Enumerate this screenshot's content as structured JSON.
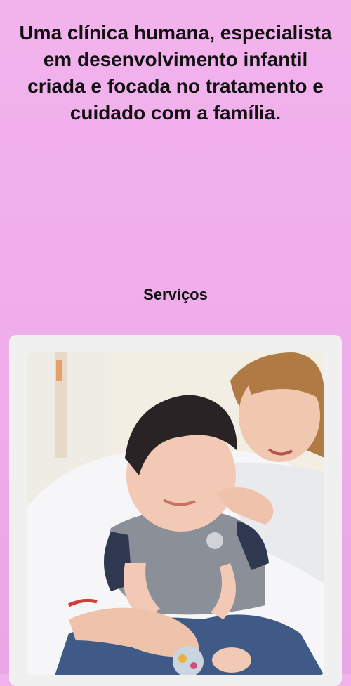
{
  "hero": {
    "text": "Uma clínica humana, especialista em desenvolvimento infantil criada e focada no tratamento e cuidado com a família."
  },
  "services": {
    "title": "Serviços",
    "card": {
      "image_alt": "Terapeuta brincando com uma criança"
    }
  }
}
